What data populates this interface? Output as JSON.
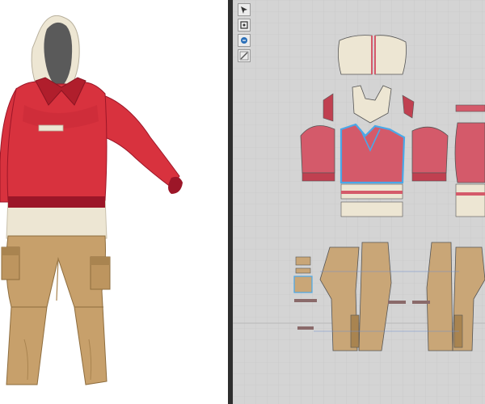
{
  "window": {
    "panels": [
      "3d-avatar-view",
      "2d-pattern-view"
    ]
  },
  "toolbar": {
    "tools": [
      {
        "icon": "select-move-icon"
      },
      {
        "icon": "transform-pattern-icon"
      },
      {
        "icon": "edit-curve-icon"
      },
      {
        "icon": "segment-icon"
      }
    ]
  },
  "colors": {
    "hoodie": "#d8323e",
    "hoodie_shadow": "#b01e2c",
    "rib": "#9c1628",
    "cream": "#ede6d3",
    "hood_lining": "#5a5a5a",
    "pants": "#c7a06b",
    "pants_shadow": "#a98450",
    "pattern_red": "#d45a6a",
    "pattern_tan": "#c9a677",
    "pattern_cream": "#ede6d3",
    "selection": "#4aa8e8",
    "grid_bg": "#d4d4d4",
    "grid_line": "#c3c3c3",
    "divider": "#2e2e2e"
  }
}
